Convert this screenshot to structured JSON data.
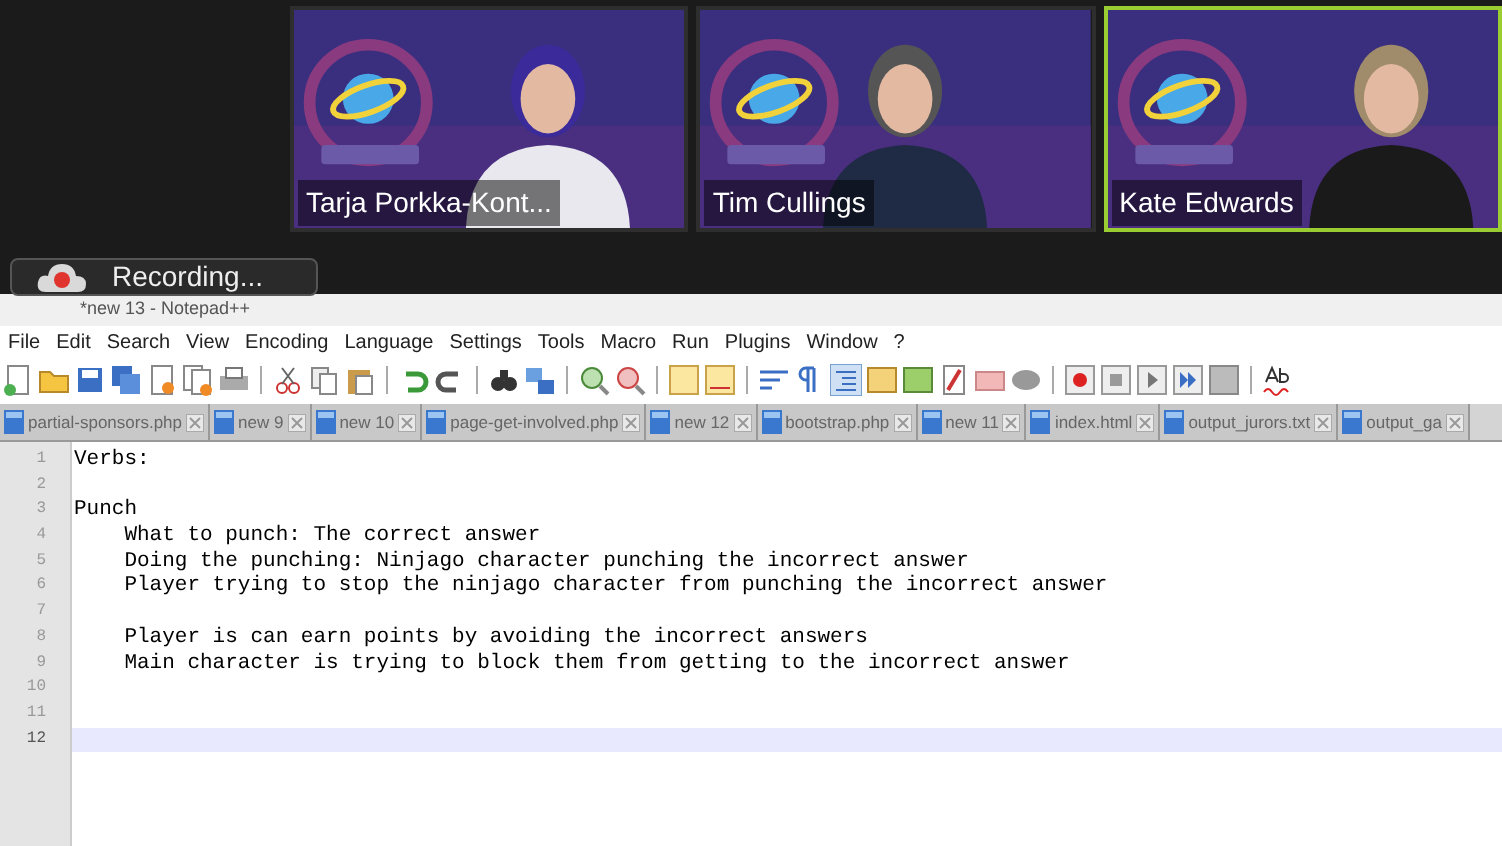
{
  "participants": [
    {
      "name": "Tarja Porkka-Kont...",
      "speaking": false
    },
    {
      "name": "Tim Cullings",
      "speaking": false
    },
    {
      "name": "Kate Edwards",
      "speaking": true
    }
  ],
  "recording": {
    "label": "Recording..."
  },
  "window": {
    "title": "*new 13 - Notepad++"
  },
  "menu": [
    "File",
    "Edit",
    "Search",
    "View",
    "Encoding",
    "Language",
    "Settings",
    "Tools",
    "Macro",
    "Run",
    "Plugins",
    "Window",
    "?"
  ],
  "tabs": [
    "partial-sponsors.php",
    "new 9",
    "new 10",
    "page-get-involved.php",
    "new 12",
    "bootstrap.php",
    "new 11",
    "index.html",
    "output_jurors.txt",
    "output_ga"
  ],
  "lines": [
    {
      "number": "1",
      "text": "Verbs:",
      "current": false
    },
    {
      "number": "2",
      "current": false
    },
    {
      "number": "3",
      "text": "Punch",
      "current": false
    },
    {
      "number": "4",
      "text": "    What to punch: The correct answer",
      "current": false
    },
    {
      "number": "5",
      "text": "    Doing the punching: Ninjago character punching the incorrect answer",
      "current": false
    },
    {
      "number": "6",
      "text": "    Player trying to stop the ninjago character from punching the incorrect answer",
      "current": false
    },
    {
      "number": "7",
      "current": false
    },
    {
      "number": "8",
      "text": "    Player is can earn points by avoiding the incorrect answers",
      "current": false
    },
    {
      "number": "9",
      "text": "    Main character is trying to block them from getting to the incorrect answer",
      "current": false
    },
    {
      "number": "10",
      "current": false
    },
    {
      "number": "11",
      "current": false
    },
    {
      "number": "12",
      "current": true
    }
  ]
}
